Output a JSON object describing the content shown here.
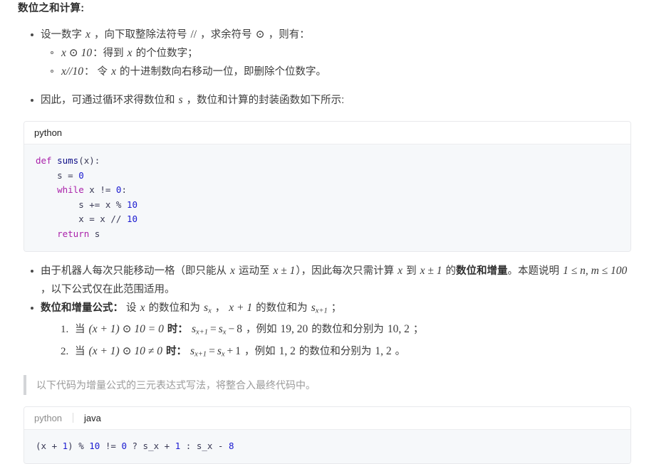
{
  "heading": "数位之和计算:",
  "bullets": {
    "b1_pre": "设一数字 ",
    "b1_x": "x",
    "b1_mid": " ，向下取整除法符号 ",
    "b1_floordiv": "//",
    "b1_mid2": " ，求余符号 ",
    "b1_mod": "⊙",
    "b1_end": " ，则有：",
    "sub1_math": "x ⊙ 10",
    "sub1_text_a": "：得到 ",
    "sub1_x": "x",
    "sub1_text_b": " 的个位数字；",
    "sub2_math": "x//10",
    "sub2_text_a": "： 令 ",
    "sub2_x": "x",
    "sub2_text_b": " 的十进制数向右移动一位，即删除个位数字。",
    "b2_pre": "因此，可通过循环求得数位和 ",
    "b2_s": "s",
    "b2_end": " ，数位和计算的封装函数如下所示:",
    "b3_p1": "由于机器人每次只能移动一格（即只能从 ",
    "b3_x1": "x",
    "b3_p2": " 运动至 ",
    "b3_xpm1": "x ± 1",
    "b3_p3": "），因此每次只需计算 ",
    "b3_x2": "x",
    "b3_p4": " 到 ",
    "b3_xpm1b": "x ± 1",
    "b3_p5": " 的",
    "b3_bold": "数位和增量",
    "b3_p6": "。本题说明 ",
    "b3_range": "1 ≤ n, m ≤ 100",
    "b3_p7": " ，以下公式仅在此范围适用。",
    "b4_bold": "数位和增量公式：",
    "b4_p1": " 设 ",
    "b4_x": "x",
    "b4_p2": " 的数位和为 ",
    "b4_sx": "s_x",
    "b4_p3": " ， ",
    "b4_xp1": "x + 1",
    "b4_p4": " 的数位和为 ",
    "b4_sx1": "s_{x+1}",
    "b4_p5": " ；"
  },
  "ordered": {
    "item1_cond_pre": "当 ",
    "item1_cond": "(x + 1) ⊙ 10 = 0",
    "item1_cond_post": " 时：",
    "item1_formula": "s_{x+1} = s_x − 8",
    "item1_tail_a": " ，例如 ",
    "item1_nums": "19, 20",
    "item1_tail_b": " 的数位和分别为 ",
    "item1_nums2": "10, 2",
    "item1_tail_c": " ；",
    "item2_cond_pre": "当 ",
    "item2_cond": "(x + 1) ⊙ 10 ≠ 0",
    "item2_cond_post": " 时：",
    "item2_formula": "s_{x+1} = s_x + 1",
    "item2_tail_a": " ，例如 ",
    "item2_nums": "1, 2",
    "item2_tail_b": " 的数位和分别为 ",
    "item2_nums2": "1, 2",
    "item2_tail_c": " 。"
  },
  "code_block_1": {
    "language_label": "python",
    "lines": [
      {
        "tokens": [
          {
            "t": "def ",
            "c": "k"
          },
          {
            "t": "sums",
            "c": "fn"
          },
          {
            "t": "(x):",
            "c": "pn"
          }
        ]
      },
      {
        "tokens": [
          {
            "t": "    s = ",
            "c": "id"
          },
          {
            "t": "0",
            "c": "nm"
          }
        ]
      },
      {
        "tokens": [
          {
            "t": "    ",
            "c": "id"
          },
          {
            "t": "while",
            "c": "k"
          },
          {
            "t": " x != ",
            "c": "id"
          },
          {
            "t": "0",
            "c": "nm"
          },
          {
            "t": ":",
            "c": "pn"
          }
        ]
      },
      {
        "tokens": [
          {
            "t": "        s += x % ",
            "c": "id"
          },
          {
            "t": "10",
            "c": "nm"
          }
        ]
      },
      {
        "tokens": [
          {
            "t": "        x = x // ",
            "c": "id"
          },
          {
            "t": "10",
            "c": "nm"
          }
        ]
      },
      {
        "tokens": [
          {
            "t": "    ",
            "c": "id"
          },
          {
            "t": "return",
            "c": "k"
          },
          {
            "t": " s",
            "c": "id"
          }
        ]
      }
    ]
  },
  "quote": {
    "text": "以下代码为增量公式的三元表达式写法，将整合入最终代码中。"
  },
  "code_block_2": {
    "tab_python": "python",
    "tab_java": "java",
    "active_tab": "java",
    "lines": [
      {
        "tokens": [
          {
            "t": "(x + ",
            "c": "id"
          },
          {
            "t": "1",
            "c": "nm"
          },
          {
            "t": ") % ",
            "c": "id"
          },
          {
            "t": "10",
            "c": "nm"
          },
          {
            "t": " != ",
            "c": "id"
          },
          {
            "t": "0",
            "c": "nm"
          },
          {
            "t": " ? s_x + ",
            "c": "id"
          },
          {
            "t": "1",
            "c": "nm"
          },
          {
            "t": " : s_x - ",
            "c": "id"
          },
          {
            "t": "8",
            "c": "nm"
          }
        ]
      }
    ]
  },
  "colors": {
    "keyword": "#aa22aa",
    "function": "#0e0e87",
    "number": "#1a1ad0",
    "identifier": "#3a3a55",
    "code_bg": "#f6f8fa",
    "header_bg": "#ffffff",
    "border": "#e8e9ec",
    "quote_border": "#d3d5d8",
    "quote_text": "#9a9a9a",
    "text": "#3d3d3d"
  }
}
